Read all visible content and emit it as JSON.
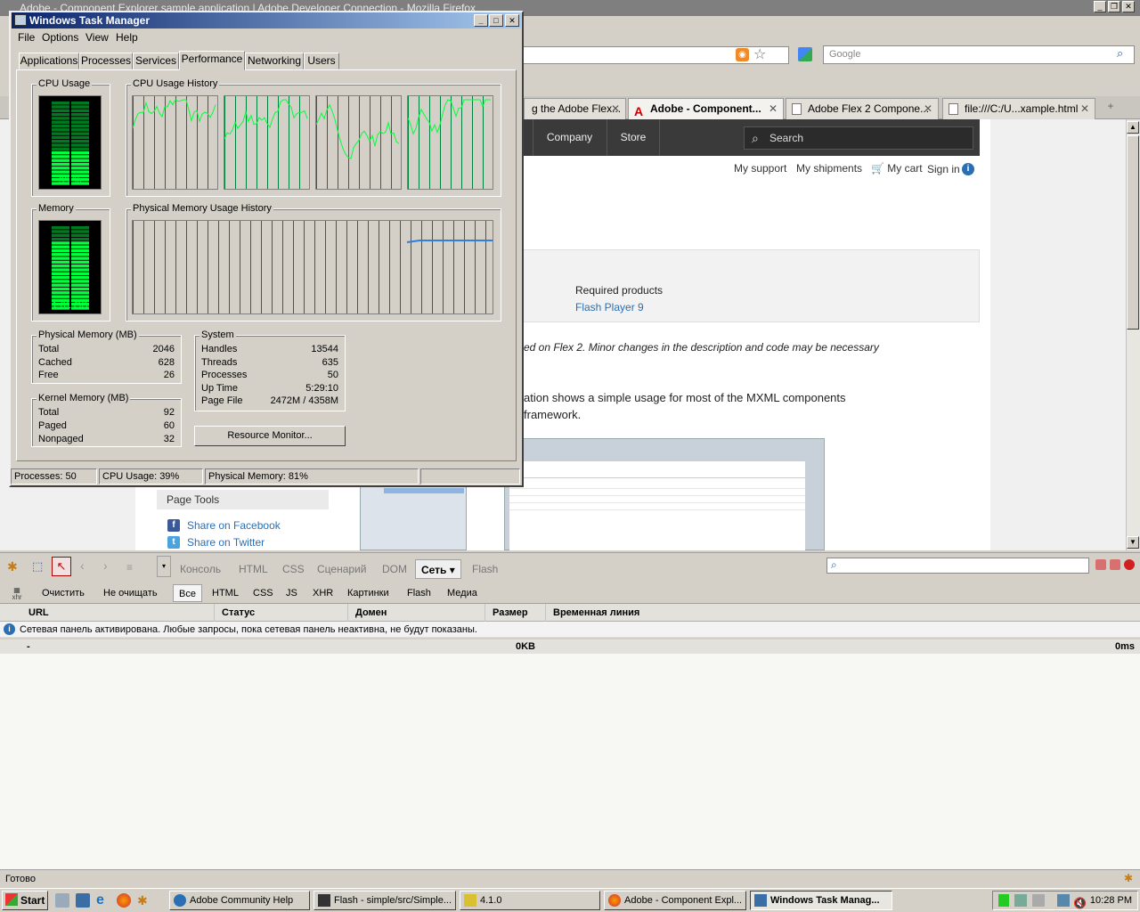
{
  "firefox": {
    "title": "Adobe - Component Explorer sample application | Adobe Developer Connection - Mozilla Firefox",
    "search_placeholder": "Google",
    "tabs": [
      {
        "label": "g the Adobe Flex..."
      },
      {
        "label": "Adobe - Component..."
      },
      {
        "label": "Adobe Flex 2 Compone..."
      },
      {
        "label": "file:///C:/U...xample.html"
      }
    ],
    "close_glyph": "✕",
    "status": "Готово"
  },
  "site": {
    "nav": [
      "Company",
      "Store"
    ],
    "search_placeholder": "Search",
    "util": [
      "My support",
      "My shipments",
      "My cart",
      "Sign in"
    ],
    "required_products_label": "Required products",
    "required_product": "Flash Player 9",
    "note": "ed on Flex 2. Minor changes in the description and code may be necessary",
    "para_line1": "ation shows a simple usage for most of the MXML components",
    "para_line2": "framework.",
    "page_tools": "Page Tools",
    "share": [
      "Share on Facebook",
      "Share on Twitter"
    ]
  },
  "firebug": {
    "tabs": [
      "Консоль",
      "HTML",
      "CSS",
      "Сценарий",
      "DOM",
      "Сеть ▾",
      "Flash"
    ],
    "selected_tab": "Сеть ▾",
    "clear": "Очистить",
    "persist": "Не очищать",
    "filters": [
      "Все",
      "HTML",
      "CSS",
      "JS",
      "XHR",
      "Картинки",
      "Flash",
      "Медиа"
    ],
    "xhr_label": "xhr",
    "columns": [
      "URL",
      "Статус",
      "Домен",
      "Размер",
      "Временная линия"
    ],
    "info": "Сетевая панель активирована. Любые запросы, пока сетевая панель неактивна, не будут показаны.",
    "summary_dash": "-",
    "summary_size": "0KB",
    "summary_time": "0ms"
  },
  "taskmgr": {
    "title": "Windows Task Manager",
    "menu": [
      "File",
      "Options",
      "View",
      "Help"
    ],
    "tabs": [
      "Applications",
      "Processes",
      "Services",
      "Performance",
      "Networking",
      "Users"
    ],
    "selected_tab": "Performance",
    "cpu_usage_label": "CPU Usage",
    "cpu_value": "39 %",
    "cpu_percent": 39,
    "cpu_history_label": "CPU Usage History",
    "memory_label": "Memory",
    "memory_value": "1.61 GB",
    "memory_fraction": 0.81,
    "mem_history_label": "Physical Memory Usage History",
    "physical": {
      "label": "Physical Memory (MB)",
      "rows": [
        [
          "Total",
          "2046"
        ],
        [
          "Cached",
          "628"
        ],
        [
          "Free",
          "26"
        ]
      ]
    },
    "kernel": {
      "label": "Kernel Memory (MB)",
      "rows": [
        [
          "Total",
          "92"
        ],
        [
          "Paged",
          "60"
        ],
        [
          "Nonpaged",
          "32"
        ]
      ]
    },
    "system": {
      "label": "System",
      "rows": [
        [
          "Handles",
          "13544"
        ],
        [
          "Threads",
          "635"
        ],
        [
          "Processes",
          "50"
        ],
        [
          "Up Time",
          "5:29:10"
        ],
        [
          "Page File",
          "2472M / 4358M"
        ]
      ]
    },
    "resource_monitor": "Resource Monitor...",
    "status": [
      "Processes: 50",
      "CPU Usage: 39%",
      "Physical Memory: 81%"
    ]
  },
  "taskbar": {
    "start": "Start",
    "buttons": [
      "Adobe Community Help",
      "Flash - simple/src/Simple...",
      "4.1.0",
      "Adobe - Component Expl...",
      "Windows Task Manag..."
    ],
    "active": "Windows Task Manag...",
    "clock": "10:28 PM"
  },
  "icons": [
    "rss-icon",
    "star-icon",
    "google-icon",
    "search-icon",
    "adobe-icon",
    "page-icon",
    "cart-icon",
    "info-icon",
    "facebook-icon",
    "twitter-icon",
    "firebug-icon",
    "inspect-icon",
    "back-icon",
    "forward-icon",
    "firefox-icon",
    "ie-icon",
    "computer-icon",
    "network-icon",
    "volume-icon"
  ],
  "colors": {
    "graph_line": "#00ff3c",
    "graph_grid": "#00803d",
    "mem_line": "#2f7fe0",
    "titlebar": "#0a246a",
    "link": "#2a6fb4"
  }
}
